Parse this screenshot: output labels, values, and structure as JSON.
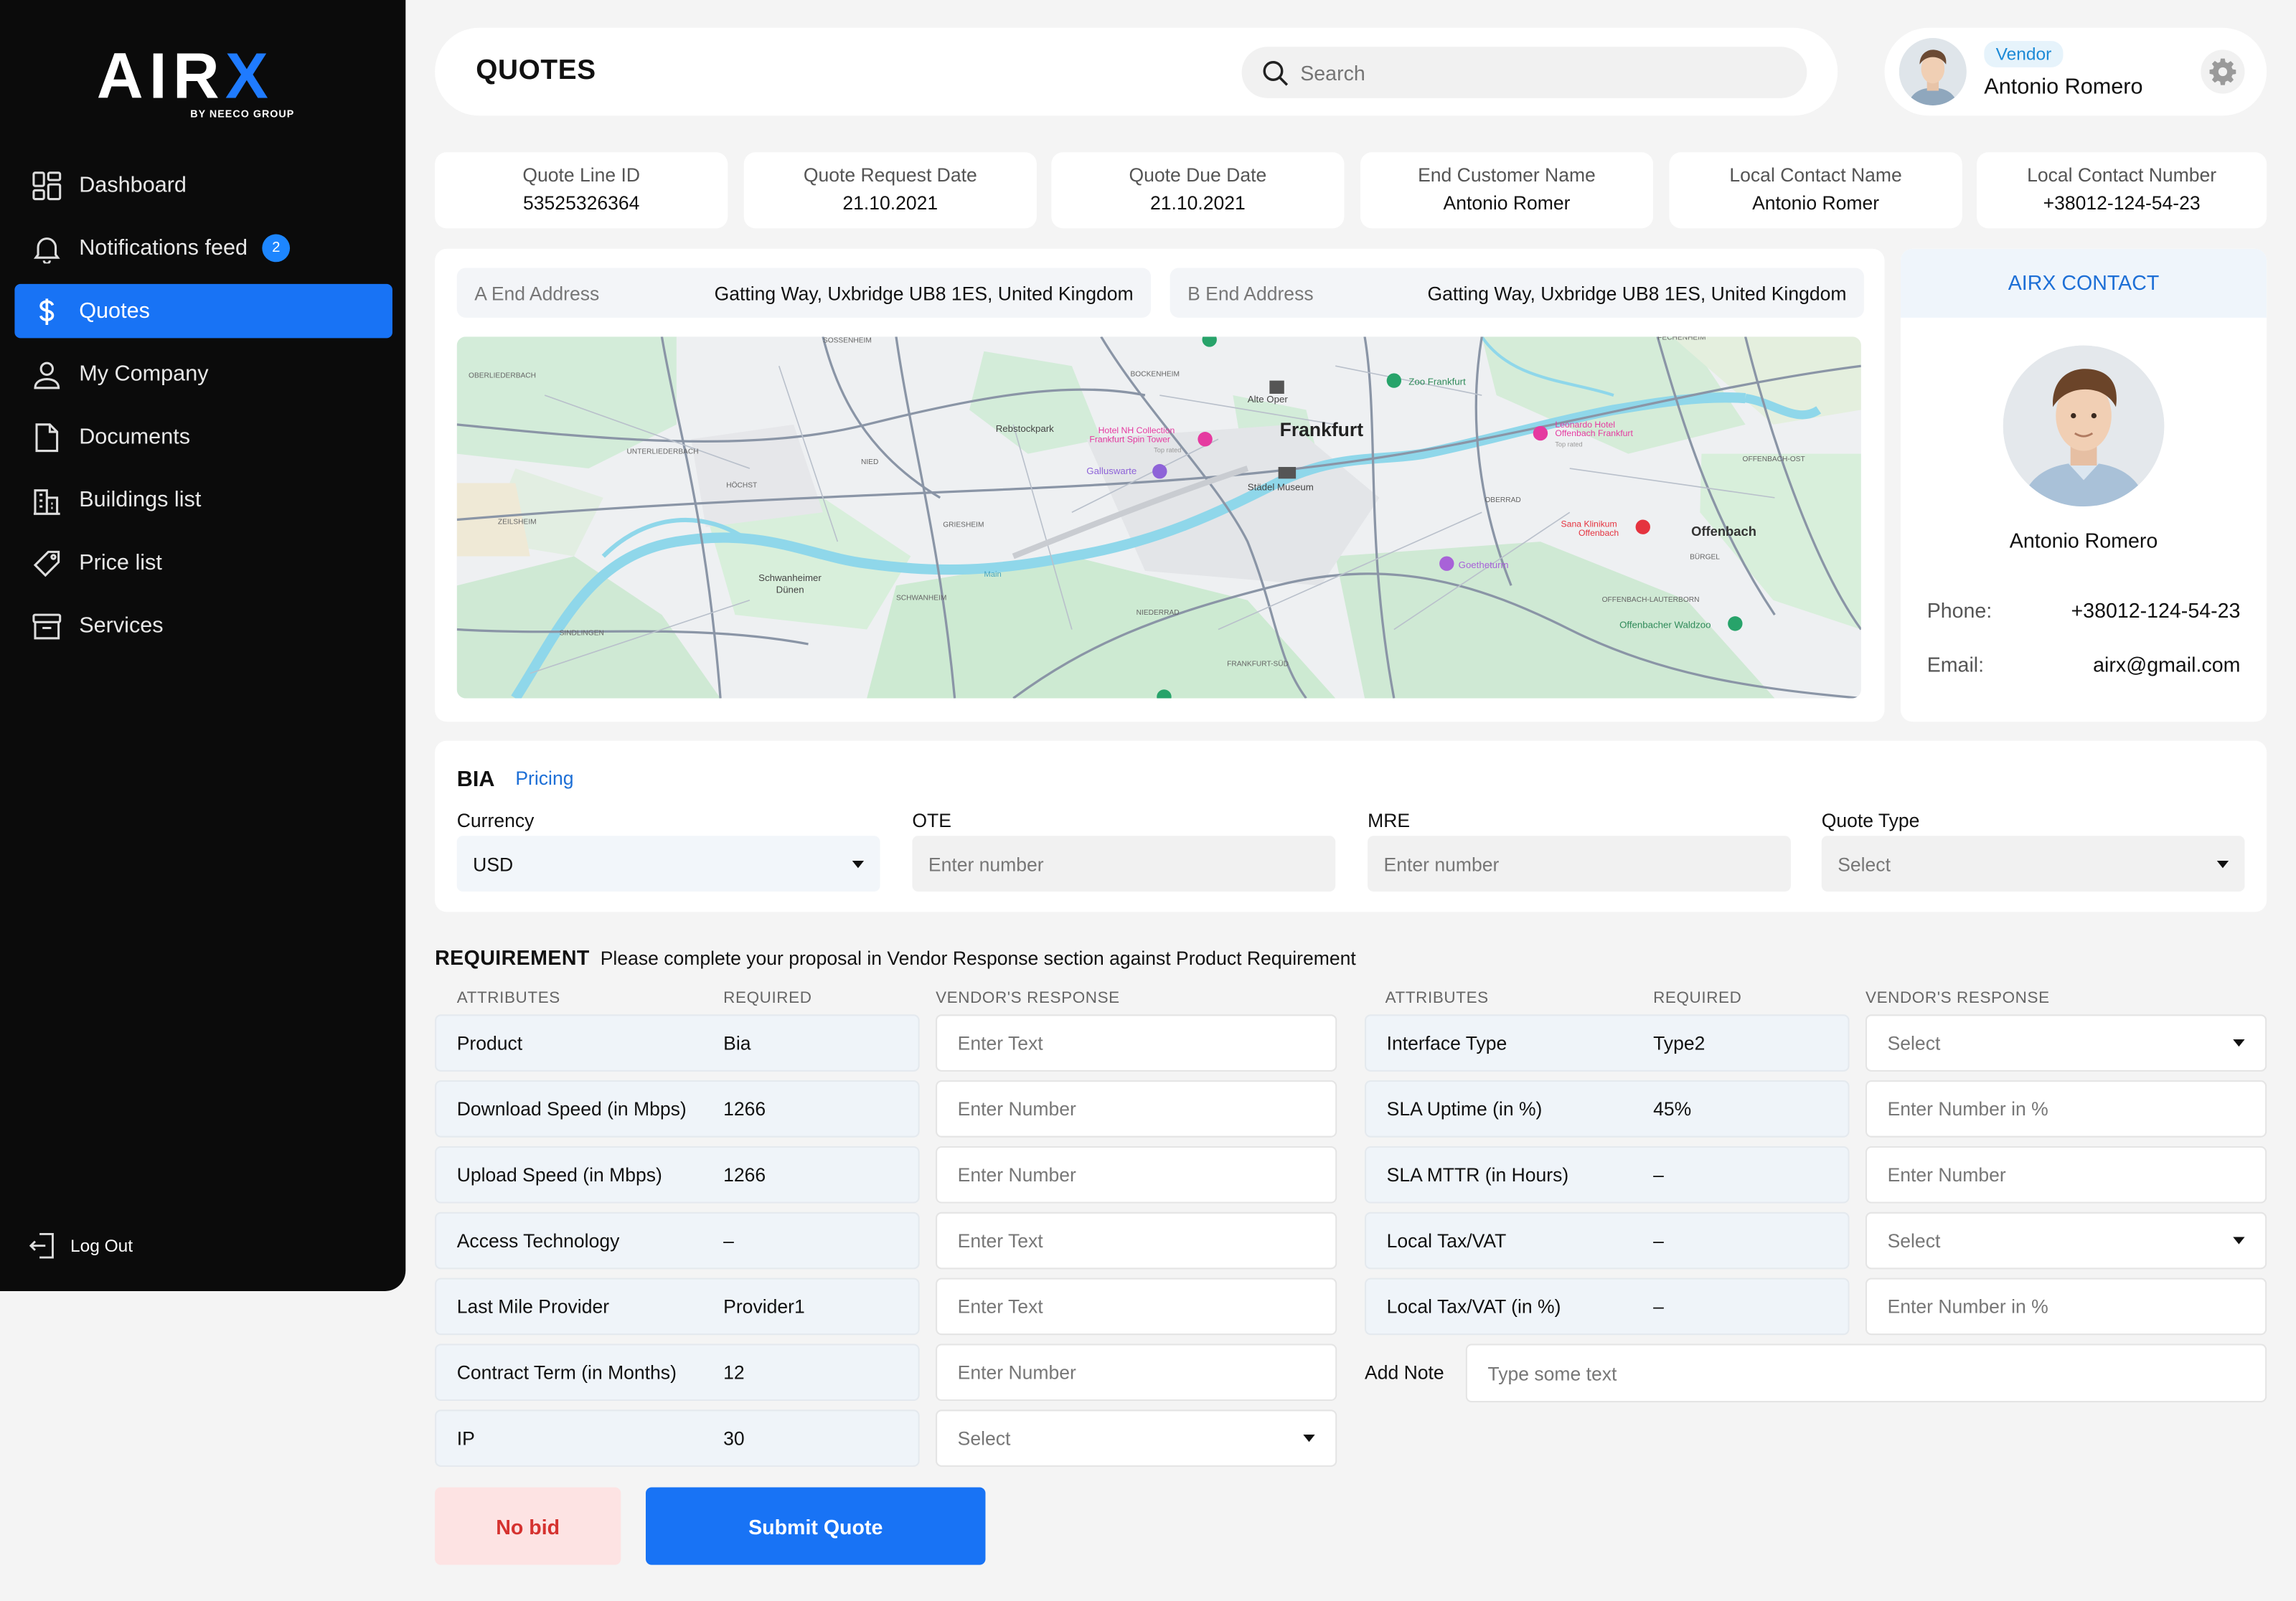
{
  "brand": {
    "logo_main": "AIRX",
    "logo_sub": "BY NEECO GROUP",
    "accent": "#1873f5"
  },
  "sidebar": {
    "items": [
      {
        "label": "Dashboard",
        "icon": "dashboard-icon"
      },
      {
        "label": "Notifications feed",
        "icon": "bell-icon",
        "badge": "2"
      },
      {
        "label": "Quotes",
        "icon": "dollar-icon",
        "active": true
      },
      {
        "label": "My Company",
        "icon": "user-icon"
      },
      {
        "label": "Documents",
        "icon": "document-icon"
      },
      {
        "label": "Buildings list",
        "icon": "building-icon"
      },
      {
        "label": "Price list",
        "icon": "tag-icon"
      },
      {
        "label": "Services",
        "icon": "archive-icon"
      }
    ],
    "logout_label": "Log Out"
  },
  "header": {
    "title": "QUOTES",
    "search_placeholder": "Search"
  },
  "profile": {
    "role": "Vendor",
    "name": "Antonio Romero"
  },
  "quote_info": [
    {
      "label": "Quote Line ID",
      "value": "53525326364"
    },
    {
      "label": "Quote Request Date",
      "value": "21.10.2021"
    },
    {
      "label": "Quote Due Date",
      "value": "21.10.2021"
    },
    {
      "label": "End Customer Name",
      "value": "Antonio Romer"
    },
    {
      "label": "Local Contact Name",
      "value": "Antonio Romer"
    },
    {
      "label": "Local Contact Number",
      "value": "+38012-124-54-23"
    }
  ],
  "addresses": {
    "a_label": "A End Address",
    "a_value": "Gatting Way, Uxbridge UB8 1ES, United Kingdom",
    "b_label": "B End Address",
    "b_value": "Gatting Way, Uxbridge UB8 1ES, United Kingdom"
  },
  "map": {
    "city": "Frankfurt",
    "city2": "Offenbach",
    "labels": [
      "Rebstockpark",
      "Hotel NH Collection Frankfurt Spin Tower",
      "Top rated",
      "Galluswarte",
      "Alte Oper",
      "Städel Museum",
      "Zoo Frankfurt",
      "Leonardo Hotel Offenbach Frankfurt",
      "Top rated",
      "Sana Klinikum Offenbach",
      "Goetheturm",
      "Schwanheimer Dünen",
      "Offenbacher Waldzoo",
      "SOSSENHEIM",
      "BOCKENHEIM",
      "FECHENHEIM",
      "OBERLIEDERBACH",
      "UNTERLIEDERBACH",
      "HÖCHST",
      "NIED",
      "GRIESHEIM",
      "ZEILSHEIM",
      "SINDLINGEN",
      "SCHWANHEIM",
      "NIEDERRAD",
      "OBERRAD",
      "FRANKFURT-SÜD",
      "OFFENBACH-LAUTERBORN",
      "BÜRGEL",
      "OFFENBACH-OST",
      "Frankfurt",
      "Main"
    ]
  },
  "airx_contact": {
    "title": "AIRX CONTACT",
    "name": "Antonio Romero",
    "phone_label": "Phone:",
    "phone": "+38012-124-54-23",
    "email_label": "Email:",
    "email": "airx@gmail.com"
  },
  "bia": {
    "title": "BIA",
    "tab": "Pricing",
    "fields": [
      {
        "label": "Currency",
        "value": "USD",
        "type": "select"
      },
      {
        "label": "OTE",
        "placeholder": "Enter number",
        "type": "input"
      },
      {
        "label": "MRE",
        "placeholder": "Enter number",
        "type": "input"
      },
      {
        "label": "Quote Type",
        "placeholder": "Select",
        "type": "select"
      }
    ]
  },
  "requirement": {
    "title": "REQUIREMENT",
    "description": "Please complete your proposal in Vendor Response section against Product Requirement",
    "col_attributes": "ATTRIBUTES",
    "col_required": "REQUIRED",
    "col_response": "VENDOR'S RESPONSE",
    "left_rows": [
      {
        "attribute": "Product",
        "required": "Bia",
        "response": "Enter Text",
        "type": "input"
      },
      {
        "attribute": "Download Speed (in Mbps)",
        "required": "1266",
        "response": "Enter Number",
        "type": "input"
      },
      {
        "attribute": "Upload Speed (in Mbps)",
        "required": "1266",
        "response": "Enter Number",
        "type": "input"
      },
      {
        "attribute": "Access Technology",
        "required": "–",
        "response": "Enter Text",
        "type": "input"
      },
      {
        "attribute": "Last Mile Provider",
        "required": "Provider1",
        "response": "Enter Text",
        "type": "input"
      },
      {
        "attribute": "Contract Term (in Months)",
        "required": "12",
        "response": "Enter Number",
        "type": "input"
      },
      {
        "attribute": "IP",
        "required": "30",
        "response": "Select",
        "type": "select"
      }
    ],
    "right_rows": [
      {
        "attribute": "Interface Type",
        "required": "Type2",
        "response": "Select",
        "type": "select"
      },
      {
        "attribute": "SLA Uptime (in %)",
        "required": "45%",
        "response": "Enter Number in %",
        "type": "input"
      },
      {
        "attribute": "SLA MTTR (in Hours)",
        "required": "–",
        "response": "Enter Number",
        "type": "input"
      },
      {
        "attribute": "Local Tax/VAT",
        "required": "–",
        "response": "Select",
        "type": "select"
      },
      {
        "attribute": "Local Tax/VAT (in %)",
        "required": "–",
        "response": "Enter Number in %",
        "type": "input"
      }
    ],
    "note_label": "Add Note",
    "note_placeholder": "Type some text"
  },
  "actions": {
    "no_bid": "No bid",
    "submit": "Submit Quote"
  }
}
